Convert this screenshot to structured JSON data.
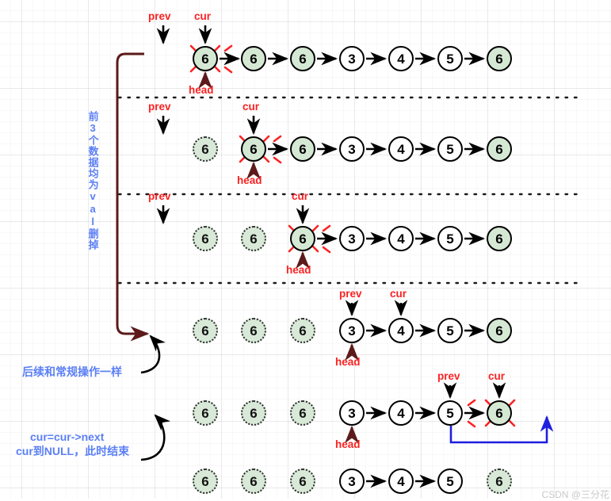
{
  "diagram": {
    "title": "Linked list remove-elements walkthrough",
    "colors": {
      "pointer_label": "#fb2222",
      "note_text": "#5b7ff5",
      "node_val_fill": "#d5e8d4",
      "node_plain_fill": "#ffffff",
      "node_stroke": "#000000",
      "delete_mark": "#fb2222",
      "bracket": "#5c1a1a",
      "null_arrow": "#1f1fe0",
      "grid": "#e8e8e8"
    },
    "notes": {
      "vertical_left": "前3个数据均为val删掉",
      "mid_left": "后续和常规操作一样",
      "bottom_left_line1": "cur=cur->next",
      "bottom_left_line2": "cur到NULL，此时结束"
    },
    "pointer_labels": {
      "prev": "prev",
      "cur": "cur",
      "head": "head"
    },
    "watermark": "CSDN @三分花",
    "rows": [
      {
        "id": "row-1",
        "nodes": [
          {
            "value": "6",
            "state": "deleting"
          },
          {
            "value": "6",
            "state": "val"
          },
          {
            "value": "6",
            "state": "val"
          },
          {
            "value": "3",
            "state": "plain"
          },
          {
            "value": "4",
            "state": "plain"
          },
          {
            "value": "5",
            "state": "plain"
          },
          {
            "value": "6",
            "state": "val"
          }
        ],
        "pointers": {
          "prev": "none",
          "cur": "node-0",
          "head": "node-0"
        }
      },
      {
        "id": "row-2",
        "nodes": [
          {
            "value": "6",
            "state": "ghost"
          },
          {
            "value": "6",
            "state": "deleting"
          },
          {
            "value": "6",
            "state": "val"
          },
          {
            "value": "3",
            "state": "plain"
          },
          {
            "value": "4",
            "state": "plain"
          },
          {
            "value": "5",
            "state": "plain"
          },
          {
            "value": "6",
            "state": "val"
          }
        ],
        "pointers": {
          "prev": "none",
          "cur": "node-1",
          "head": "node-1"
        }
      },
      {
        "id": "row-3",
        "nodes": [
          {
            "value": "6",
            "state": "ghost"
          },
          {
            "value": "6",
            "state": "ghost"
          },
          {
            "value": "6",
            "state": "deleting"
          },
          {
            "value": "3",
            "state": "plain"
          },
          {
            "value": "4",
            "state": "plain"
          },
          {
            "value": "5",
            "state": "plain"
          },
          {
            "value": "6",
            "state": "val"
          }
        ],
        "pointers": {
          "prev": "none",
          "cur": "node-2",
          "head": "node-2"
        }
      },
      {
        "id": "row-4",
        "nodes": [
          {
            "value": "6",
            "state": "ghost"
          },
          {
            "value": "6",
            "state": "ghost"
          },
          {
            "value": "6",
            "state": "ghost"
          },
          {
            "value": "3",
            "state": "plain"
          },
          {
            "value": "4",
            "state": "plain"
          },
          {
            "value": "5",
            "state": "plain"
          },
          {
            "value": "6",
            "state": "val"
          }
        ],
        "pointers": {
          "prev": "node-3",
          "cur": "node-4",
          "head": "node-3"
        }
      },
      {
        "id": "row-5",
        "nodes": [
          {
            "value": "6",
            "state": "ghost"
          },
          {
            "value": "6",
            "state": "ghost"
          },
          {
            "value": "6",
            "state": "ghost"
          },
          {
            "value": "3",
            "state": "plain"
          },
          {
            "value": "4",
            "state": "plain"
          },
          {
            "value": "5",
            "state": "plain"
          },
          {
            "value": "6",
            "state": "deleting"
          }
        ],
        "pointers": {
          "prev": "node-5",
          "cur": "node-6",
          "head": "node-3"
        },
        "null_link": "node-5 -> NULL"
      },
      {
        "id": "row-6",
        "nodes": [
          {
            "value": "6",
            "state": "ghost"
          },
          {
            "value": "6",
            "state": "ghost"
          },
          {
            "value": "6",
            "state": "ghost"
          },
          {
            "value": "3",
            "state": "plain"
          },
          {
            "value": "4",
            "state": "plain"
          },
          {
            "value": "5",
            "state": "plain"
          },
          {
            "value": "6",
            "state": "ghost"
          }
        ],
        "pointers": {
          "prev": "none",
          "cur": "none",
          "head": "none"
        }
      }
    ]
  }
}
